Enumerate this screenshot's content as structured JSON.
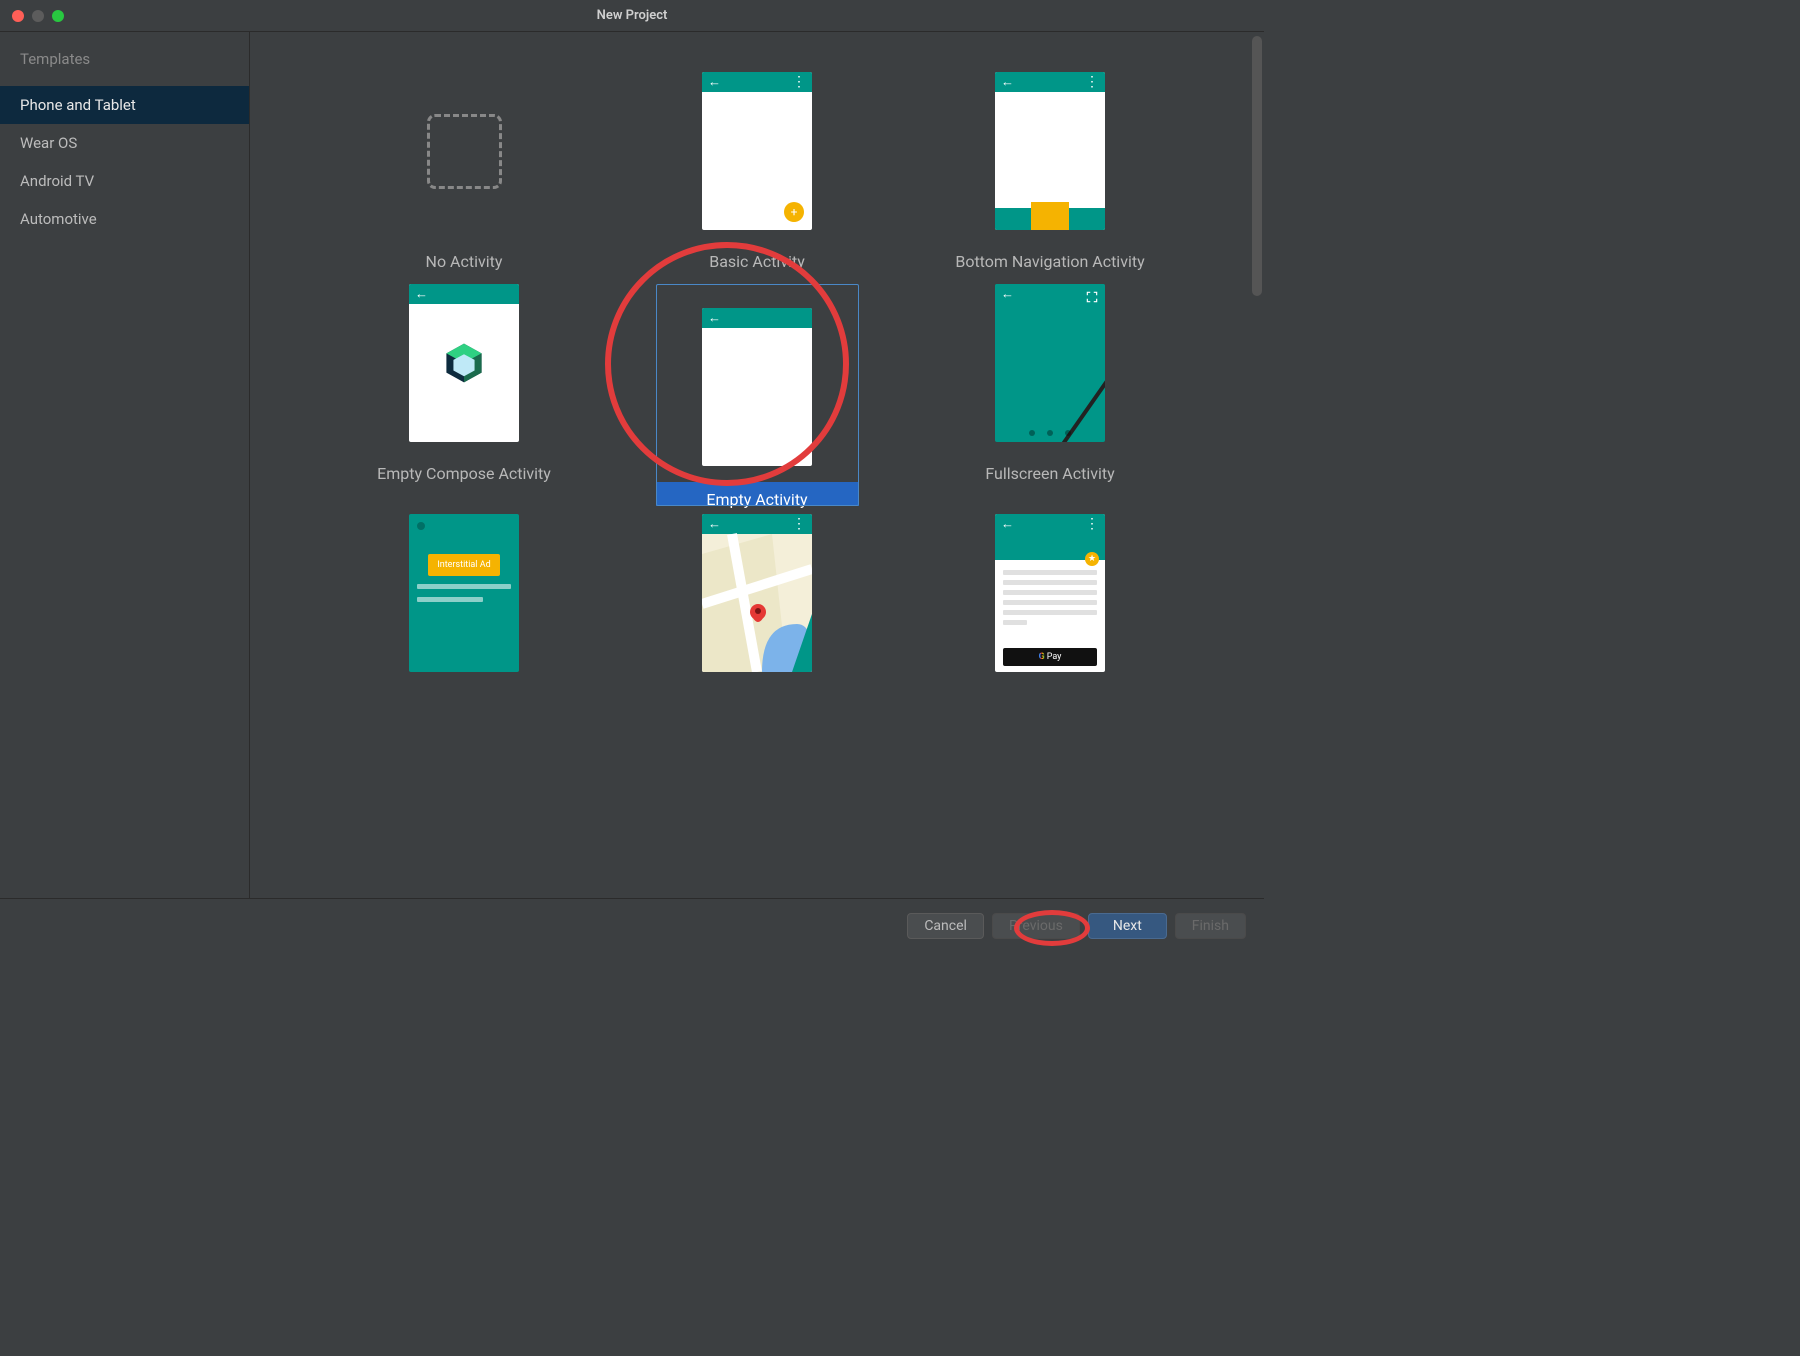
{
  "window": {
    "title": "New Project"
  },
  "sidebar": {
    "title": "Templates",
    "items": [
      {
        "label": "Phone and Tablet",
        "active": true
      },
      {
        "label": "Wear OS",
        "active": false
      },
      {
        "label": "Android TV",
        "active": false
      },
      {
        "label": "Automotive",
        "active": false
      }
    ]
  },
  "templates": [
    {
      "id": "no-activity",
      "label": "No Activity",
      "selected": false
    },
    {
      "id": "basic-activity",
      "label": "Basic Activity",
      "selected": false
    },
    {
      "id": "bottom-nav-activity",
      "label": "Bottom Navigation Activity",
      "selected": false
    },
    {
      "id": "empty-compose-activity",
      "label": "Empty Compose Activity",
      "selected": false
    },
    {
      "id": "empty-activity",
      "label": "Empty Activity",
      "selected": true
    },
    {
      "id": "fullscreen-activity",
      "label": "Fullscreen Activity",
      "selected": false
    },
    {
      "id": "ad-activity",
      "label": "",
      "selected": false
    },
    {
      "id": "maps-activity",
      "label": "",
      "selected": false
    },
    {
      "id": "pay-activity",
      "label": "",
      "selected": false
    }
  ],
  "ad": {
    "button_label": "Interstitial Ad"
  },
  "pay": {
    "button_label": "Pay",
    "logo_letter": "G"
  },
  "footer": {
    "cancel": "Cancel",
    "previous": "Previous",
    "next": "Next",
    "finish": "Finish"
  },
  "colors": {
    "teal": "#009688",
    "accent_yellow": "#f5b301",
    "selection_blue": "#2566c2",
    "annotation_red": "#e23c3c"
  }
}
